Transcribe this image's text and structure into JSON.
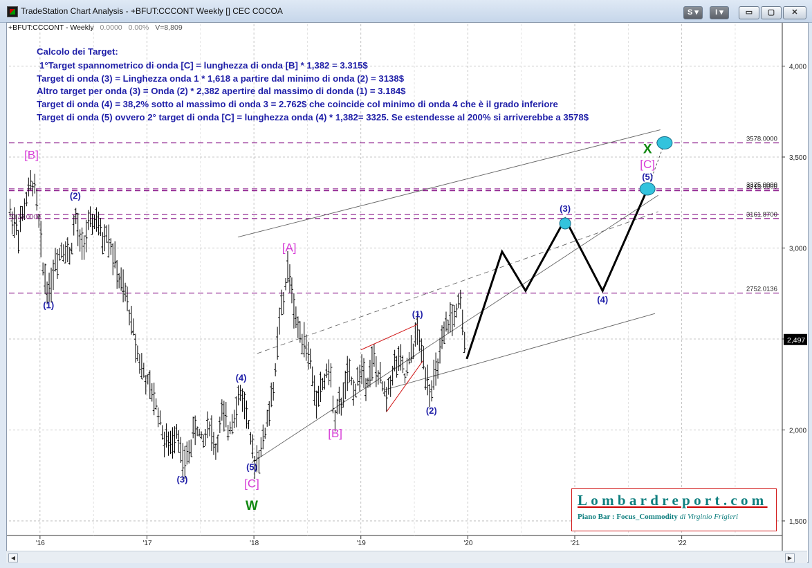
{
  "window": {
    "title": "TradeStation Chart Analysis - +BFUT:CCCONT Weekly [] CEC COCOA",
    "buttons": {
      "s": "S ▾",
      "i": "I ▾",
      "minimize": "▭",
      "maximize": "▢",
      "close": "✕"
    }
  },
  "status": {
    "symbol": "+BFUT:CCCONT - Weekly",
    "change": "0.0000",
    "pct": "0.00%",
    "volume": "V=8,809"
  },
  "annotations": {
    "heading": "Calcolo dei Target:",
    "lines": [
      "1°Target spannometrico di onda [C] = lunghezza di onda [B] * 1,382 = 3.315$",
      "Target di onda (3) = Linghezza onda 1 * 1,618 a partire dal minimo di onda (2) = 3138$",
      "Altro target per onda (3) = Onda (2) * 2,382  apertire dal massimo di donda (1) = 3.184$",
      "Target di onda (4) = 38,2% sotto al massimo di onda 3 = 2.762$ che coincide col minimo di onda 4 che è il grado inferiore",
      "Target di onda (5) ovvero 2° target di onda [C] = lunghezza onda (4) * 1,382= 3325.  Se estendesse al 200% si arriverebbe a 3578$"
    ]
  },
  "branding": {
    "name": "Lombardreport.com",
    "subtitle": "Piano Bar : Focus_Commodity",
    "author": "di Virginio Frigieri"
  },
  "colors": {
    "bars": "#000000",
    "hline": "#8b1a8b",
    "wave_label": "#1f1fa8",
    "big_label": "#d63cd6",
    "w_label": "#118811",
    "projection": "#000000",
    "target_circle": "#33c3dd",
    "last_price_bg": "#000000",
    "red_wedge": "#d21a1a"
  },
  "chart_data": {
    "type": "bar",
    "ylim": [
      1420,
      4230
    ],
    "y_ticks": [
      1500,
      2000,
      2500,
      3000,
      3500,
      4000
    ],
    "y_tick_labels": [
      "1,500",
      "2,000",
      "2,500",
      "3,000",
      "3,500",
      "4,000"
    ],
    "x_ticks": [
      2016,
      2017,
      2018,
      2019,
      2020,
      2021,
      2022
    ],
    "x_tick_labels": [
      "'16",
      "'17",
      "'18",
      "'19",
      "'20",
      "'21",
      "'22"
    ],
    "xlim": [
      2015.71,
      2022.94
    ],
    "last_price": 2497,
    "last_price_label": "2,497",
    "horizontal_levels": [
      {
        "value": 3578,
        "label": "3578.0000"
      },
      {
        "value": 3325,
        "label": "3325.0000"
      },
      {
        "value": 3315,
        "label": "3315.0000"
      },
      {
        "value": 3184,
        "label": ""
      },
      {
        "value": 3161.87,
        "label": "3161.8700"
      },
      {
        "value": 2752.0136,
        "label": "2752.0136"
      }
    ],
    "left_level_label": "3174.0000",
    "price_path": [
      [
        2015.72,
        3200
      ],
      [
        2015.8,
        3090
      ],
      [
        2015.88,
        3280
      ],
      [
        2015.94,
        3380
      ],
      [
        2015.98,
        3200
      ],
      [
        2016.03,
        2880
      ],
      [
        2016.08,
        2760
      ],
      [
        2016.15,
        2940
      ],
      [
        2016.22,
        3020
      ],
      [
        2016.28,
        2950
      ],
      [
        2016.33,
        3180
      ],
      [
        2016.38,
        3000
      ],
      [
        2016.45,
        3100
      ],
      [
        2016.52,
        3170
      ],
      [
        2016.58,
        3040
      ],
      [
        2016.63,
        3100
      ],
      [
        2016.68,
        2970
      ],
      [
        2016.74,
        2820
      ],
      [
        2016.82,
        2700
      ],
      [
        2016.88,
        2520
      ],
      [
        2016.95,
        2340
      ],
      [
        2017.02,
        2230
      ],
      [
        2017.1,
        2120
      ],
      [
        2017.16,
        1950
      ],
      [
        2017.22,
        1900
      ],
      [
        2017.28,
        2030
      ],
      [
        2017.34,
        1790
      ],
      [
        2017.4,
        1900
      ],
      [
        2017.46,
        2030
      ],
      [
        2017.52,
        1920
      ],
      [
        2017.58,
        2060
      ],
      [
        2017.64,
        1880
      ],
      [
        2017.7,
        2080
      ],
      [
        2017.76,
        2000
      ],
      [
        2017.82,
        2110
      ],
      [
        2017.88,
        2210
      ],
      [
        2017.93,
        2100
      ],
      [
        2017.98,
        1870
      ],
      [
        2018.02,
        1840
      ],
      [
        2018.08,
        1920
      ],
      [
        2018.14,
        2100
      ],
      [
        2018.2,
        2300
      ],
      [
        2018.24,
        2620
      ],
      [
        2018.28,
        2700
      ],
      [
        2018.31,
        2900
      ],
      [
        2018.35,
        2780
      ],
      [
        2018.4,
        2580
      ],
      [
        2018.46,
        2520
      ],
      [
        2018.52,
        2400
      ],
      [
        2018.58,
        2150
      ],
      [
        2018.64,
        2240
      ],
      [
        2018.7,
        2350
      ],
      [
        2018.76,
        2060
      ],
      [
        2018.82,
        2160
      ],
      [
        2018.88,
        2300
      ],
      [
        2018.94,
        2220
      ],
      [
        2019.0,
        2330
      ],
      [
        2019.06,
        2280
      ],
      [
        2019.12,
        2380
      ],
      [
        2019.18,
        2260
      ],
      [
        2019.24,
        2180
      ],
      [
        2019.3,
        2340
      ],
      [
        2019.36,
        2380
      ],
      [
        2019.42,
        2280
      ],
      [
        2019.48,
        2440
      ],
      [
        2019.53,
        2550
      ],
      [
        2019.56,
        2440
      ],
      [
        2019.6,
        2350
      ],
      [
        2019.65,
        2220
      ],
      [
        2019.7,
        2300
      ],
      [
        2019.76,
        2460
      ],
      [
        2019.82,
        2600
      ],
      [
        2019.88,
        2630
      ],
      [
        2019.93,
        2690
      ],
      [
        2019.98,
        2400
      ]
    ],
    "projection": [
      [
        2019.99,
        2390
      ],
      [
        2020.32,
        2980
      ],
      [
        2020.54,
        2765
      ],
      [
        2020.91,
        3160
      ],
      [
        2021.26,
        2765
      ],
      [
        2021.68,
        3325
      ]
    ],
    "projection_dashed": [
      [
        2021.68,
        3325
      ],
      [
        2021.84,
        3578
      ]
    ],
    "target_circles": [
      [
        2021.84,
        3578
      ],
      [
        2021.68,
        3325
      ],
      [
        2020.91,
        3135
      ]
    ],
    "channel_lines": [
      {
        "from": [
          2017.98,
          1820
        ],
        "to": [
          2021.78,
          3290
        ],
        "style": "solid"
      },
      {
        "from": [
          2017.85,
          3060
        ],
        "to": [
          2021.8,
          3650
        ],
        "style": "solid"
      },
      {
        "from": [
          2018.03,
          2420
        ],
        "to": [
          2021.78,
          3200
        ],
        "style": "dashed"
      },
      {
        "from": [
          2019.22,
          2220
        ],
        "to": [
          2021.75,
          2640
        ],
        "style": "solid"
      }
    ],
    "red_wedge": [
      {
        "from": [
          2019.0,
          2440
        ],
        "to": [
          2019.53,
          2580
        ]
      },
      {
        "from": [
          2019.24,
          2100
        ],
        "to": [
          2019.58,
          2380
        ]
      }
    ],
    "labels": [
      {
        "text": "[B]",
        "x": 2015.92,
        "y": 3490,
        "kind": "big"
      },
      {
        "text": "(2)",
        "x": 2016.33,
        "y": 3270,
        "kind": "wave"
      },
      {
        "text": "(1)",
        "x": 2016.08,
        "y": 2670,
        "kind": "wave"
      },
      {
        "text": "(3)",
        "x": 2017.33,
        "y": 1710,
        "kind": "wave"
      },
      {
        "text": "(4)",
        "x": 2017.88,
        "y": 2270,
        "kind": "wave"
      },
      {
        "text": "(5)",
        "x": 2017.98,
        "y": 1780,
        "kind": "wave"
      },
      {
        "text": "[C]",
        "x": 2017.98,
        "y": 1685,
        "kind": "big"
      },
      {
        "text": "W",
        "x": 2017.98,
        "y": 1560,
        "kind": "w"
      },
      {
        "text": "[A]",
        "x": 2018.33,
        "y": 2980,
        "kind": "big"
      },
      {
        "text": "[B]",
        "x": 2018.76,
        "y": 1960,
        "kind": "big"
      },
      {
        "text": "(1)",
        "x": 2019.53,
        "y": 2620,
        "kind": "wave"
      },
      {
        "text": "(2)",
        "x": 2019.66,
        "y": 2090,
        "kind": "wave"
      },
      {
        "text": "(3)",
        "x": 2020.91,
        "y": 3200,
        "kind": "wave"
      },
      {
        "text": "(4)",
        "x": 2021.26,
        "y": 2700,
        "kind": "wave"
      },
      {
        "text": "(5)",
        "x": 2021.68,
        "y": 3375,
        "kind": "wave"
      },
      {
        "text": "[C]",
        "x": 2021.68,
        "y": 3440,
        "kind": "big"
      },
      {
        "text": "X",
        "x": 2021.68,
        "y": 3520,
        "kind": "w"
      }
    ]
  }
}
